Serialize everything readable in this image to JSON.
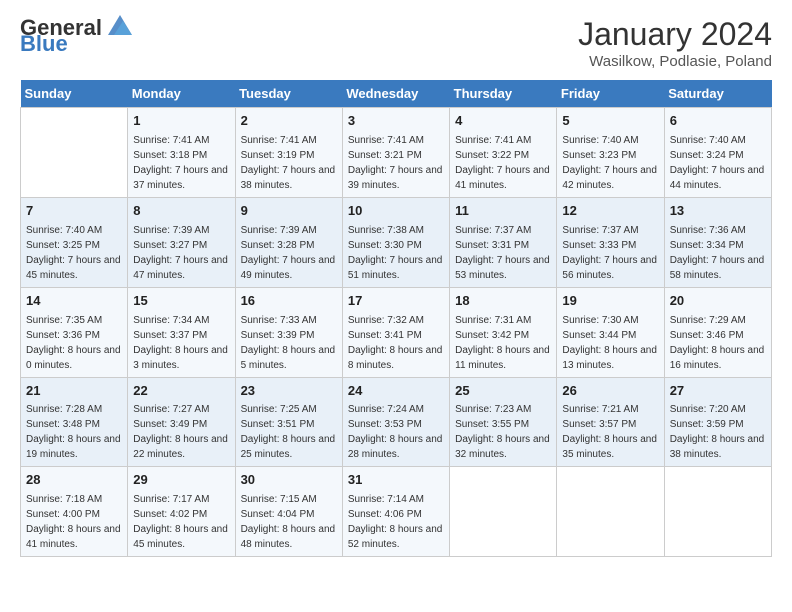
{
  "header": {
    "logo_text_general": "General",
    "logo_text_blue": "Blue",
    "month_title": "January 2024",
    "subtitle": "Wasilkow, Podlasie, Poland"
  },
  "days_of_week": [
    "Sunday",
    "Monday",
    "Tuesday",
    "Wednesday",
    "Thursday",
    "Friday",
    "Saturday"
  ],
  "weeks": [
    [
      {
        "day": "",
        "sunrise": "",
        "sunset": "",
        "daylight": ""
      },
      {
        "day": "1",
        "sunrise": "Sunrise: 7:41 AM",
        "sunset": "Sunset: 3:18 PM",
        "daylight": "Daylight: 7 hours and 37 minutes."
      },
      {
        "day": "2",
        "sunrise": "Sunrise: 7:41 AM",
        "sunset": "Sunset: 3:19 PM",
        "daylight": "Daylight: 7 hours and 38 minutes."
      },
      {
        "day": "3",
        "sunrise": "Sunrise: 7:41 AM",
        "sunset": "Sunset: 3:21 PM",
        "daylight": "Daylight: 7 hours and 39 minutes."
      },
      {
        "day": "4",
        "sunrise": "Sunrise: 7:41 AM",
        "sunset": "Sunset: 3:22 PM",
        "daylight": "Daylight: 7 hours and 41 minutes."
      },
      {
        "day": "5",
        "sunrise": "Sunrise: 7:40 AM",
        "sunset": "Sunset: 3:23 PM",
        "daylight": "Daylight: 7 hours and 42 minutes."
      },
      {
        "day": "6",
        "sunrise": "Sunrise: 7:40 AM",
        "sunset": "Sunset: 3:24 PM",
        "daylight": "Daylight: 7 hours and 44 minutes."
      }
    ],
    [
      {
        "day": "7",
        "sunrise": "Sunrise: 7:40 AM",
        "sunset": "Sunset: 3:25 PM",
        "daylight": "Daylight: 7 hours and 45 minutes."
      },
      {
        "day": "8",
        "sunrise": "Sunrise: 7:39 AM",
        "sunset": "Sunset: 3:27 PM",
        "daylight": "Daylight: 7 hours and 47 minutes."
      },
      {
        "day": "9",
        "sunrise": "Sunrise: 7:39 AM",
        "sunset": "Sunset: 3:28 PM",
        "daylight": "Daylight: 7 hours and 49 minutes."
      },
      {
        "day": "10",
        "sunrise": "Sunrise: 7:38 AM",
        "sunset": "Sunset: 3:30 PM",
        "daylight": "Daylight: 7 hours and 51 minutes."
      },
      {
        "day": "11",
        "sunrise": "Sunrise: 7:37 AM",
        "sunset": "Sunset: 3:31 PM",
        "daylight": "Daylight: 7 hours and 53 minutes."
      },
      {
        "day": "12",
        "sunrise": "Sunrise: 7:37 AM",
        "sunset": "Sunset: 3:33 PM",
        "daylight": "Daylight: 7 hours and 56 minutes."
      },
      {
        "day": "13",
        "sunrise": "Sunrise: 7:36 AM",
        "sunset": "Sunset: 3:34 PM",
        "daylight": "Daylight: 7 hours and 58 minutes."
      }
    ],
    [
      {
        "day": "14",
        "sunrise": "Sunrise: 7:35 AM",
        "sunset": "Sunset: 3:36 PM",
        "daylight": "Daylight: 8 hours and 0 minutes."
      },
      {
        "day": "15",
        "sunrise": "Sunrise: 7:34 AM",
        "sunset": "Sunset: 3:37 PM",
        "daylight": "Daylight: 8 hours and 3 minutes."
      },
      {
        "day": "16",
        "sunrise": "Sunrise: 7:33 AM",
        "sunset": "Sunset: 3:39 PM",
        "daylight": "Daylight: 8 hours and 5 minutes."
      },
      {
        "day": "17",
        "sunrise": "Sunrise: 7:32 AM",
        "sunset": "Sunset: 3:41 PM",
        "daylight": "Daylight: 8 hours and 8 minutes."
      },
      {
        "day": "18",
        "sunrise": "Sunrise: 7:31 AM",
        "sunset": "Sunset: 3:42 PM",
        "daylight": "Daylight: 8 hours and 11 minutes."
      },
      {
        "day": "19",
        "sunrise": "Sunrise: 7:30 AM",
        "sunset": "Sunset: 3:44 PM",
        "daylight": "Daylight: 8 hours and 13 minutes."
      },
      {
        "day": "20",
        "sunrise": "Sunrise: 7:29 AM",
        "sunset": "Sunset: 3:46 PM",
        "daylight": "Daylight: 8 hours and 16 minutes."
      }
    ],
    [
      {
        "day": "21",
        "sunrise": "Sunrise: 7:28 AM",
        "sunset": "Sunset: 3:48 PM",
        "daylight": "Daylight: 8 hours and 19 minutes."
      },
      {
        "day": "22",
        "sunrise": "Sunrise: 7:27 AM",
        "sunset": "Sunset: 3:49 PM",
        "daylight": "Daylight: 8 hours and 22 minutes."
      },
      {
        "day": "23",
        "sunrise": "Sunrise: 7:25 AM",
        "sunset": "Sunset: 3:51 PM",
        "daylight": "Daylight: 8 hours and 25 minutes."
      },
      {
        "day": "24",
        "sunrise": "Sunrise: 7:24 AM",
        "sunset": "Sunset: 3:53 PM",
        "daylight": "Daylight: 8 hours and 28 minutes."
      },
      {
        "day": "25",
        "sunrise": "Sunrise: 7:23 AM",
        "sunset": "Sunset: 3:55 PM",
        "daylight": "Daylight: 8 hours and 32 minutes."
      },
      {
        "day": "26",
        "sunrise": "Sunrise: 7:21 AM",
        "sunset": "Sunset: 3:57 PM",
        "daylight": "Daylight: 8 hours and 35 minutes."
      },
      {
        "day": "27",
        "sunrise": "Sunrise: 7:20 AM",
        "sunset": "Sunset: 3:59 PM",
        "daylight": "Daylight: 8 hours and 38 minutes."
      }
    ],
    [
      {
        "day": "28",
        "sunrise": "Sunrise: 7:18 AM",
        "sunset": "Sunset: 4:00 PM",
        "daylight": "Daylight: 8 hours and 41 minutes."
      },
      {
        "day": "29",
        "sunrise": "Sunrise: 7:17 AM",
        "sunset": "Sunset: 4:02 PM",
        "daylight": "Daylight: 8 hours and 45 minutes."
      },
      {
        "day": "30",
        "sunrise": "Sunrise: 7:15 AM",
        "sunset": "Sunset: 4:04 PM",
        "daylight": "Daylight: 8 hours and 48 minutes."
      },
      {
        "day": "31",
        "sunrise": "Sunrise: 7:14 AM",
        "sunset": "Sunset: 4:06 PM",
        "daylight": "Daylight: 8 hours and 52 minutes."
      },
      {
        "day": "",
        "sunrise": "",
        "sunset": "",
        "daylight": ""
      },
      {
        "day": "",
        "sunrise": "",
        "sunset": "",
        "daylight": ""
      },
      {
        "day": "",
        "sunrise": "",
        "sunset": "",
        "daylight": ""
      }
    ]
  ]
}
